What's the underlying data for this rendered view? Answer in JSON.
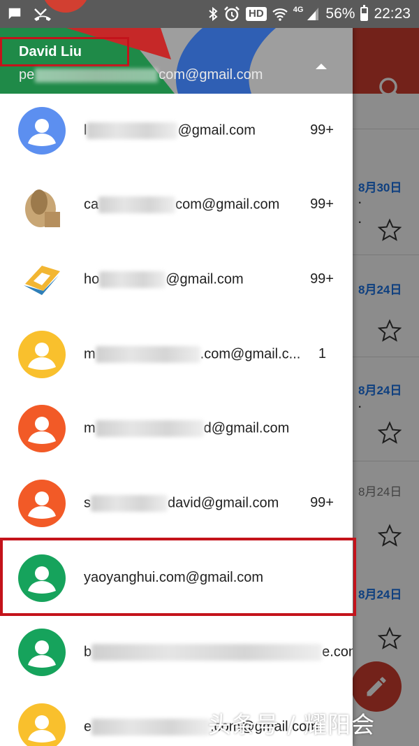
{
  "status_bar": {
    "battery": "56%",
    "time": "22:23",
    "hd": "HD",
    "network": "4G"
  },
  "drawer": {
    "account_name": "David Liu",
    "account_email_prefix": "pe",
    "account_email_suffix": "com@gmail.com"
  },
  "accounts": [
    {
      "prefix": "l",
      "suffix": "@gmail.com",
      "count": "99+",
      "avatar": "default",
      "color": "#5c8ff0"
    },
    {
      "prefix": "ca",
      "suffix": "com@gmail.com",
      "count": "99+",
      "avatar": "photo"
    },
    {
      "prefix": "ho",
      "suffix": "@gmail.com",
      "count": "99+",
      "avatar": "logo"
    },
    {
      "prefix": "m",
      "suffix": ".com@gmail.c...",
      "count": "1",
      "avatar": "default",
      "color": "#f9c02d"
    },
    {
      "prefix": "m",
      "suffix": "d@gmail.com",
      "count": "",
      "avatar": "default",
      "color": "#f25a27"
    },
    {
      "prefix": "s",
      "suffix": "david@gmail.com",
      "count": "99+",
      "avatar": "default",
      "color": "#f25a27"
    },
    {
      "prefix": "",
      "suffix": "yaoyanghui.com@gmail.com",
      "count": "",
      "avatar": "default",
      "color": "#16a35c"
    },
    {
      "prefix": "b",
      "suffix": "e.com...",
      "count": "",
      "avatar": "default",
      "color": "#16a35c"
    },
    {
      "prefix": "e",
      "suffix": ".com@gmail.com",
      "count": "",
      "avatar": "default",
      "color": "#f9c02d"
    }
  ],
  "inbox_background": {
    "dates": [
      "8月30日",
      "8月24日",
      "8月24日",
      "8月24日",
      "8月24日"
    ]
  },
  "watermark": "头条号 / 耀阳会"
}
